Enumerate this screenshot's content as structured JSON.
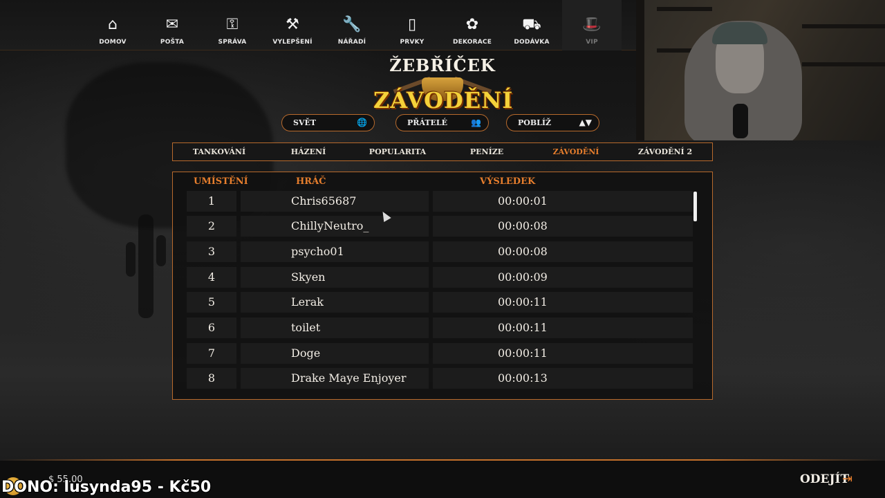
{
  "nav": {
    "items": [
      {
        "label": "DOMOV",
        "icon": "home-icon",
        "glyph": "⌂"
      },
      {
        "label": "POŠTA",
        "icon": "mail-icon",
        "glyph": "✉"
      },
      {
        "label": "SPRÁVA",
        "icon": "key-icon",
        "glyph": "⚿"
      },
      {
        "label": "VYLEPŠENÍ",
        "icon": "hammer-icon",
        "glyph": "⚒"
      },
      {
        "label": "NÁŘADÍ",
        "icon": "wrench-icon",
        "glyph": "🔧"
      },
      {
        "label": "PRVKY",
        "icon": "door-icon",
        "glyph": "▯"
      },
      {
        "label": "DEKORACE",
        "icon": "flower-icon",
        "glyph": "✿"
      },
      {
        "label": "DODÁVKA",
        "icon": "truck-icon",
        "glyph": "⛟"
      },
      {
        "label": "VIP",
        "icon": "hat-icon",
        "glyph": "🎩"
      }
    ]
  },
  "title": {
    "top": "ŽEBŘÍČEK",
    "main": "ZÁVODĚNÍ"
  },
  "filters": [
    {
      "label": "SVĚT",
      "icon": "globe-icon",
      "glyph": "🌐"
    },
    {
      "label": "PŘÁTELÉ",
      "icon": "friends-icon",
      "glyph": "👥"
    },
    {
      "label": "POBLÍŽ",
      "icon": "nearby-icon",
      "glyph": "▲▼"
    }
  ],
  "tabs": [
    "TANKOVÁNÍ",
    "HÁZENÍ",
    "POPULARITA",
    "PENÍZE",
    "ZÁVODĚNÍ",
    "ZÁVODĚNÍ 2"
  ],
  "active_tab": "ZÁVODĚNÍ",
  "board": {
    "headers": {
      "rank": "UMÍSTĚNÍ",
      "player": "HRÁČ",
      "result": "VÝSLEDEK"
    },
    "rows": [
      {
        "rank": "1",
        "player": "Chris65687",
        "result": "00:00:01"
      },
      {
        "rank": "2",
        "player": "ChillyNeutro_",
        "result": "00:00:08"
      },
      {
        "rank": "3",
        "player": "psycho01",
        "result": "00:00:08"
      },
      {
        "rank": "4",
        "player": "Skyen",
        "result": "00:00:09"
      },
      {
        "rank": "5",
        "player": "Lerak",
        "result": "00:00:11"
      },
      {
        "rank": "6",
        "player": "toilet",
        "result": "00:00:11"
      },
      {
        "rank": "7",
        "player": "Doge",
        "result": "00:00:11"
      },
      {
        "rank": "8",
        "player": "Drake Maye Enjoyer",
        "result": "00:00:13"
      }
    ]
  },
  "footer": {
    "money": "$ 55.00",
    "donation": "DONO: lusynda95 - Kč50",
    "exit_label": "ODEJÍT"
  },
  "colors": {
    "accent": "#e67e2d",
    "border": "#b86a2c",
    "title_gold": "#f4d23a"
  }
}
